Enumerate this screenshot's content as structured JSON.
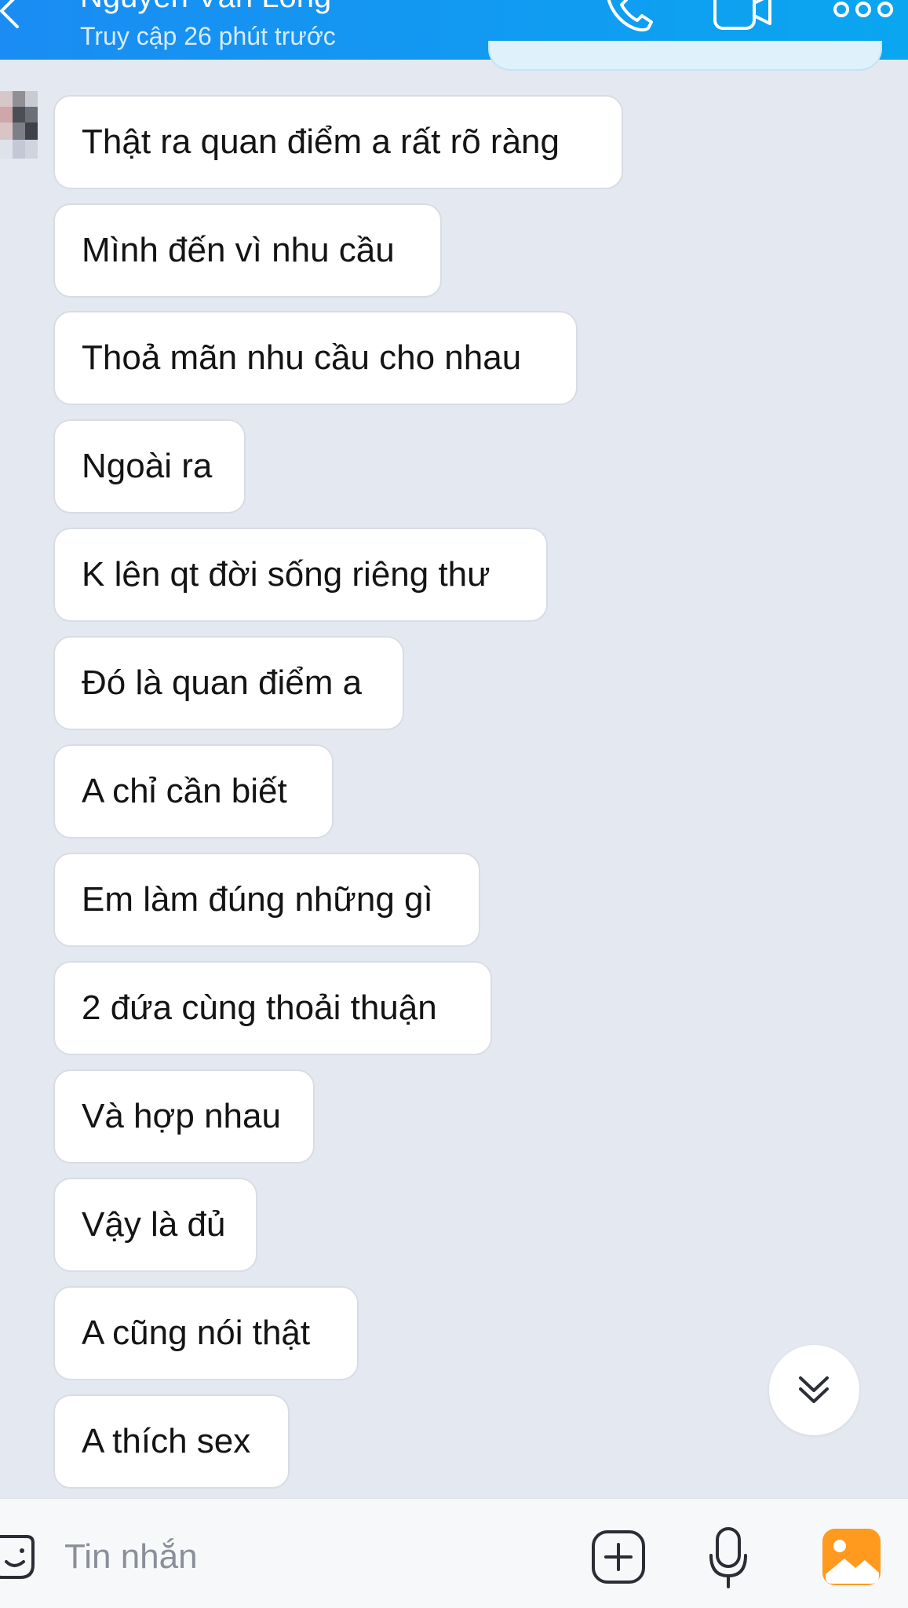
{
  "header": {
    "contact_name": "Nguyễn Văn Long",
    "status": "Truy cập 26 phút trước",
    "icons": [
      "back-icon",
      "phone-icon",
      "video-camera-icon",
      "more-icon"
    ]
  },
  "messages": [
    {
      "text": "Thật ra quan điểm a rất rõ ràng"
    },
    {
      "text": "Mình đến vì nhu cầu"
    },
    {
      "text": "Thoả mãn nhu cầu cho nhau"
    },
    {
      "text": "Ngoài ra"
    },
    {
      "text": "K lên qt đời sống riêng thư"
    },
    {
      "text": "Đó là quan điểm a"
    },
    {
      "text": "A chỉ cần biết"
    },
    {
      "text": "Em làm đúng những gì"
    },
    {
      "text": "2 đứa cùng thoải thuận"
    },
    {
      "text": "Và hợp nhau"
    },
    {
      "text": "Vậy là đủ"
    },
    {
      "text": "A cũng nói thật"
    },
    {
      "text": "A thích sex"
    }
  ],
  "composer": {
    "placeholder": "Tin nhắn",
    "value": "",
    "icons": [
      "sticker-icon",
      "plus-icon",
      "microphone-icon",
      "image-icon"
    ]
  },
  "colors": {
    "header_start": "#1a8cf3",
    "header_end": "#0aa6f0",
    "background": "#e4e8f1",
    "bubble": "#ffffff",
    "image_icon": "#ff9a1f"
  }
}
